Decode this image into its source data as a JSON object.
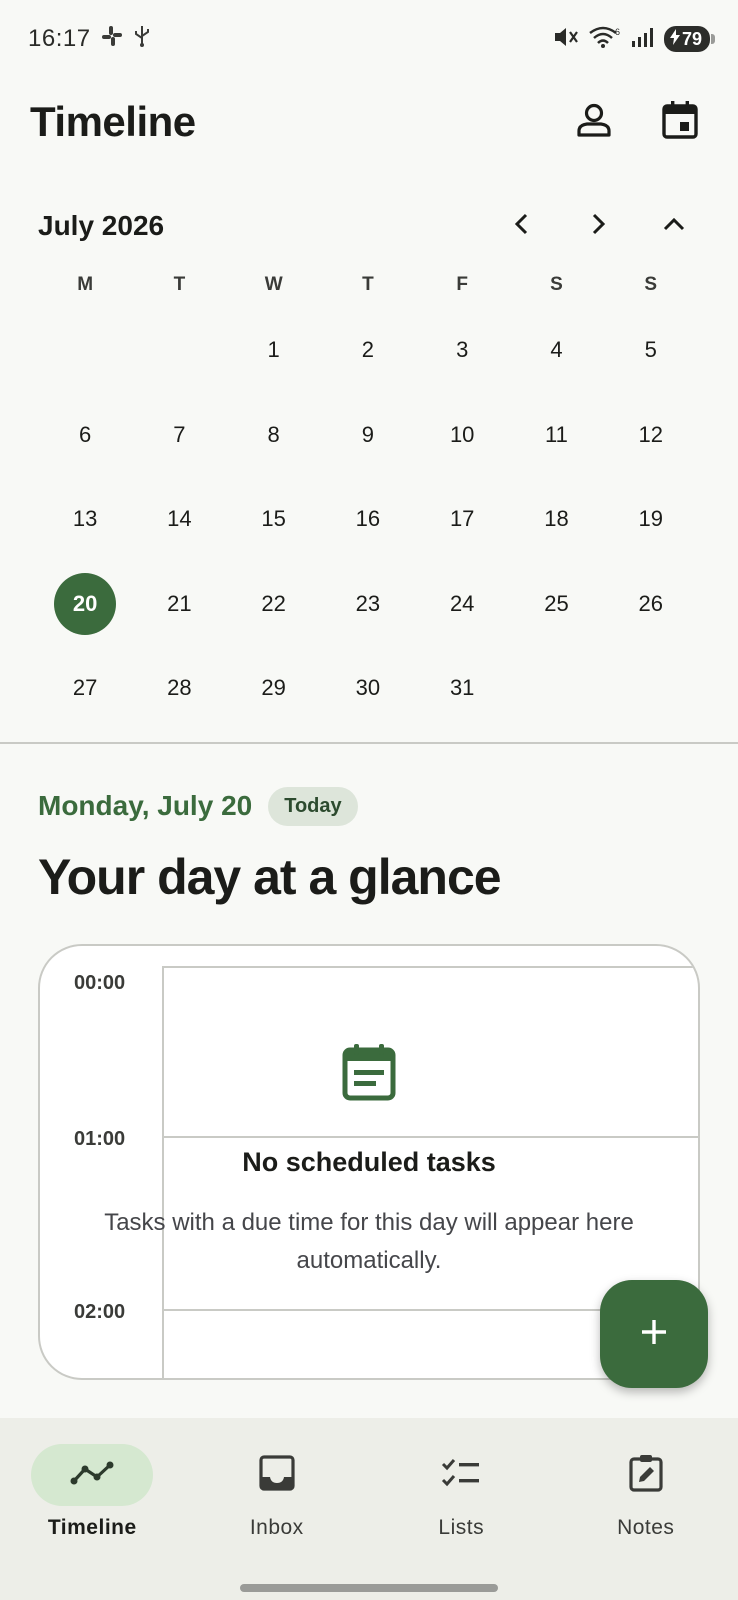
{
  "status_bar": {
    "time": "16:17",
    "battery": "79"
  },
  "app_bar": {
    "title": "Timeline"
  },
  "calendar": {
    "month_label": "July 2026",
    "weekdays": [
      "M",
      "T",
      "W",
      "T",
      "F",
      "S",
      "S"
    ],
    "days": [
      "",
      "",
      "1",
      "2",
      "3",
      "4",
      "5",
      "6",
      "7",
      "8",
      "9",
      "10",
      "11",
      "12",
      "13",
      "14",
      "15",
      "16",
      "17",
      "18",
      "19",
      "20",
      "21",
      "22",
      "23",
      "24",
      "25",
      "26",
      "27",
      "28",
      "29",
      "30",
      "31",
      "",
      ""
    ],
    "selected_day": "20"
  },
  "day_view": {
    "date_label": "Monday, July 20",
    "today_chip": "Today",
    "headline": "Your day at a glance",
    "hours": [
      "00:00",
      "01:00",
      "02:00"
    ],
    "empty_title": "No scheduled tasks",
    "empty_subtitle": "Tasks with a due time for this day will appear here automatically."
  },
  "bottom_nav": {
    "items": [
      {
        "label": "Timeline",
        "icon": "timeline-icon",
        "active": true
      },
      {
        "label": "Inbox",
        "icon": "inbox-icon",
        "active": false
      },
      {
        "label": "Lists",
        "icon": "checklist-icon",
        "active": false
      },
      {
        "label": "Notes",
        "icon": "note-edit-icon",
        "active": false
      }
    ]
  },
  "colors": {
    "accent": "#3b6b3d",
    "chip_bg": "#dde5da",
    "nav_active_bg": "#d5e8d0"
  }
}
